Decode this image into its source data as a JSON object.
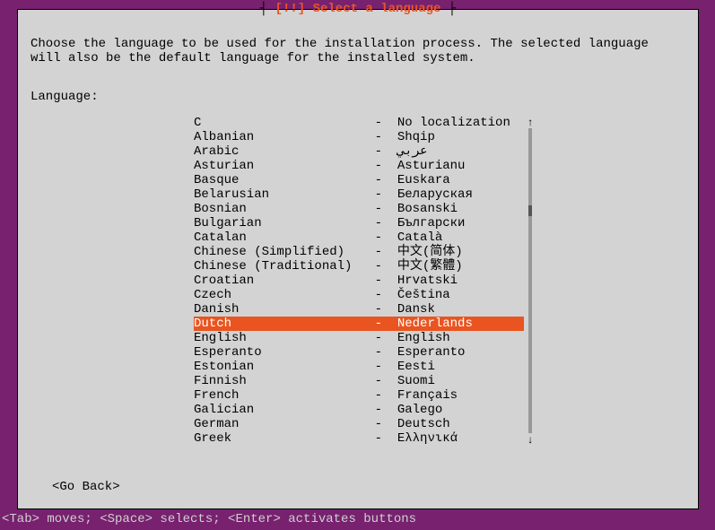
{
  "dialog": {
    "title": "[!!] Select a language",
    "description": "Choose the language to be used for the installation process. The selected language will also be the default language for the installed system.",
    "language_label": "Language:",
    "go_back": "<Go Back>",
    "selected_index": 14,
    "languages": [
      {
        "name": "C",
        "native": "No localization"
      },
      {
        "name": "Albanian",
        "native": "Shqip"
      },
      {
        "name": "Arabic",
        "native": "عربي"
      },
      {
        "name": "Asturian",
        "native": "Asturianu"
      },
      {
        "name": "Basque",
        "native": "Euskara"
      },
      {
        "name": "Belarusian",
        "native": "Беларуская"
      },
      {
        "name": "Bosnian",
        "native": "Bosanski"
      },
      {
        "name": "Bulgarian",
        "native": "Български"
      },
      {
        "name": "Catalan",
        "native": "Català"
      },
      {
        "name": "Chinese (Simplified)",
        "native": "中文(简体)"
      },
      {
        "name": "Chinese (Traditional)",
        "native": "中文(繁體)"
      },
      {
        "name": "Croatian",
        "native": "Hrvatski"
      },
      {
        "name": "Czech",
        "native": "Čeština"
      },
      {
        "name": "Danish",
        "native": "Dansk"
      },
      {
        "name": "Dutch",
        "native": "Nederlands"
      },
      {
        "name": "English",
        "native": "English"
      },
      {
        "name": "Esperanto",
        "native": "Esperanto"
      },
      {
        "name": "Estonian",
        "native": "Eesti"
      },
      {
        "name": "Finnish",
        "native": "Suomi"
      },
      {
        "name": "French",
        "native": "Français"
      },
      {
        "name": "Galician",
        "native": "Galego"
      },
      {
        "name": "German",
        "native": "Deutsch"
      },
      {
        "name": "Greek",
        "native": "Ελληνικά"
      }
    ]
  },
  "footer": "<Tab> moves; <Space> selects; <Enter> activates buttons"
}
